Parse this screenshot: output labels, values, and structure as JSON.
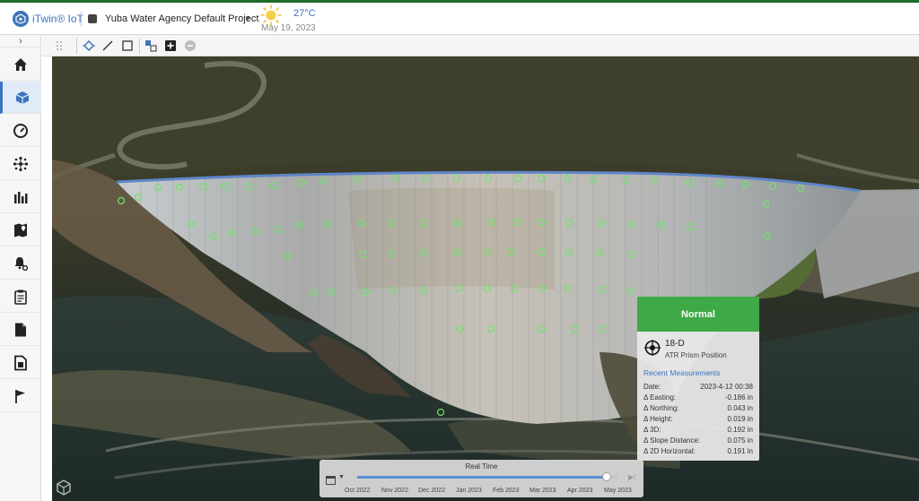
{
  "header": {
    "app_title": "iTwin® IoT",
    "project_name": "Yuba Water Agency Default Project",
    "temperature": "27°C",
    "date": "May 19, 2023",
    "weather_icon": "sun-icon"
  },
  "sidebar": {
    "items": [
      {
        "name": "home",
        "icon": "home-icon"
      },
      {
        "name": "model",
        "icon": "cube-icon",
        "active": true
      },
      {
        "name": "dashboard",
        "icon": "gauge-icon"
      },
      {
        "name": "network",
        "icon": "network-icon"
      },
      {
        "name": "analytics",
        "icon": "bar-chart-icon"
      },
      {
        "name": "map",
        "icon": "map-pin-icon"
      },
      {
        "name": "alerts",
        "icon": "bell-settings-icon"
      },
      {
        "name": "reports",
        "icon": "clipboard-icon"
      },
      {
        "name": "documents",
        "icon": "document-icon"
      },
      {
        "name": "files",
        "icon": "file-icon"
      },
      {
        "name": "flags",
        "icon": "flag-icon"
      }
    ]
  },
  "toolbar": {
    "tools": [
      "drag-handle",
      "select-point",
      "measure-line",
      "select-rectangle",
      "grouping",
      "add",
      "remove"
    ]
  },
  "card": {
    "status": "Normal",
    "status_color": "#3fa847",
    "sensor_id": "18-D",
    "sensor_type": "ATR Prism Position",
    "section_title": "Recent Measurements",
    "rows": [
      {
        "label": "Date:",
        "value": "2023-4-12 00:38"
      },
      {
        "label": "Δ Easting:",
        "value": "-0.186 in"
      },
      {
        "label": "Δ Northing:",
        "value": "0.043 in"
      },
      {
        "label": "Δ Height:",
        "value": "0.019 in"
      },
      {
        "label": "Δ 3D:",
        "value": "0.192 in"
      },
      {
        "label": "Δ Slope Distance:",
        "value": "0.075 in"
      },
      {
        "label": "Δ 2D Horizontal:",
        "value": "0.191 in"
      }
    ]
  },
  "timeline": {
    "title": "Real Time",
    "progress": 0.96,
    "labels": [
      "Oct 2022",
      "Nov 2022",
      "Dec 2022",
      "Jan 2023",
      "Feb 2023",
      "Mar 2023",
      "Apr 2023",
      "May 2023"
    ]
  }
}
